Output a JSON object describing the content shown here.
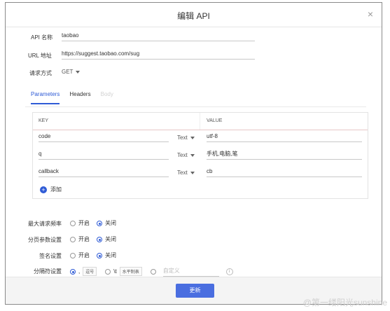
{
  "dialog": {
    "title": "编辑 API",
    "close_icon": "×"
  },
  "form": {
    "api_name_label": "API 名称",
    "api_name_value": "taobao",
    "url_label": "URL 地址",
    "url_value": "https://suggest.taobao.com/sug",
    "method_label": "请求方式",
    "method_value": "GET"
  },
  "tabs": [
    {
      "label": "Parameters",
      "state": "active"
    },
    {
      "label": "Headers",
      "state": "normal"
    },
    {
      "label": "Body",
      "state": "disabled"
    }
  ],
  "params": {
    "key_header": "KEY",
    "value_header": "VALUE",
    "rows": [
      {
        "key": "code",
        "type": "Text",
        "value": "utf-8"
      },
      {
        "key": "q",
        "type": "Text",
        "value": "手机,电脑,笔"
      },
      {
        "key": "callback",
        "type": "Text",
        "value": "cb"
      }
    ],
    "add_label": "添加"
  },
  "settings": {
    "rate_label": "最大请求频率",
    "paging_label": "分页参数设置",
    "sign_label": "签名设置",
    "separator_label": "分隔符设置",
    "on_label": "开启",
    "off_label": "关闭",
    "sep_comma": ",",
    "sep_comma_tag": "逗号",
    "sep_tab": "\\t",
    "sep_tab_tag": "水平制表",
    "sep_custom_placeholder": "自定义"
  },
  "footer": {
    "update_label": "更新"
  },
  "watermark": "@第一缕阳光sunshine",
  "colors": {
    "accent": "#2f5bd6",
    "button": "#4a6ee0"
  }
}
